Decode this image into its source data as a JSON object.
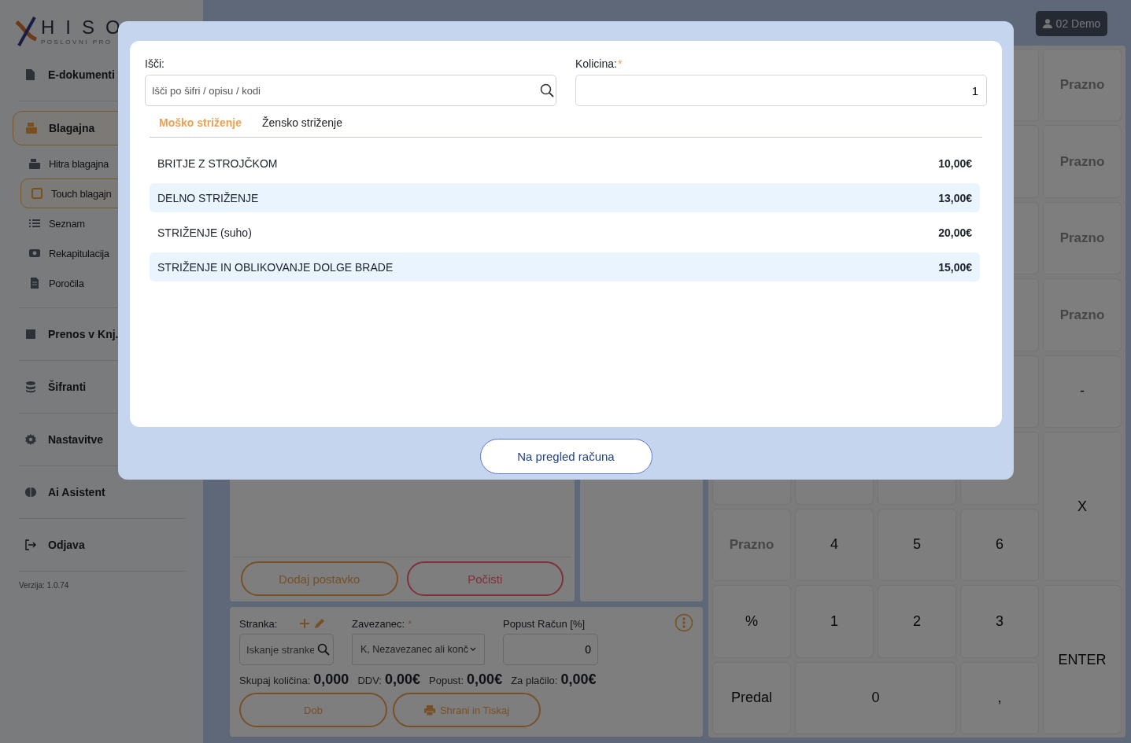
{
  "sidebar": {
    "logo": {
      "name": "HISO",
      "tagline": "POSLOVNI PRO"
    },
    "items": [
      {
        "label": "E-dokumenti",
        "selected": false
      },
      {
        "label": "Blagajna",
        "selected": true,
        "children": [
          {
            "label": "Hitra blagajna",
            "selected": false
          },
          {
            "label": "Touch blagajn",
            "selected": true
          },
          {
            "label": "Seznam",
            "selected": false
          },
          {
            "label": "Rekapitulacija",
            "selected": false
          },
          {
            "label": "Poročila",
            "selected": false
          }
        ]
      },
      {
        "label": "Prenos v Knj.",
        "selected": false
      },
      {
        "label": "Šifranti",
        "selected": false
      },
      {
        "label": "Nastavitve",
        "selected": false
      },
      {
        "label": "Ai Asistent",
        "selected": false
      },
      {
        "label": "Odjava",
        "selected": false
      }
    ],
    "version": "Verzija: 1.0.74"
  },
  "header": {
    "user_button": "02 Demo"
  },
  "receipt": {
    "buttons": [
      {
        "label": "Dodaj postavko",
        "kind": "add"
      },
      {
        "label": "Počisti",
        "kind": "clear"
      }
    ]
  },
  "customer": {
    "customer_label": "Stranka:",
    "customer_placeholder": "Iskanje stranke",
    "taxpayer_label": "Zavezanec:",
    "required_mark": "*",
    "taxpayer_value": "K, Nezavezanec ali konč",
    "discount_label": "Popust Račun [%]",
    "discount_value": "0",
    "totals": [
      {
        "label": "Skupaj količina:",
        "value": "0,000"
      },
      {
        "label": "DDV:",
        "value": "0,00€"
      },
      {
        "label": "Popust:",
        "value": "0,00€"
      },
      {
        "label": "Za plačilo:",
        "value": "0,00€"
      }
    ],
    "buttons": [
      {
        "label": "Dob",
        "kind": "plain"
      },
      {
        "label": "Shrani in Tiskaj",
        "kind": "print"
      }
    ]
  },
  "keypad": [
    {
      "label": "Prazno",
      "disabled": true
    },
    {
      "label": "Prazno",
      "disabled": true
    },
    {
      "label": "Prazno",
      "disabled": true
    },
    {
      "label": "Prazno",
      "disabled": true
    },
    {
      "label": "-",
      "disabled": false
    },
    {
      "label": "X",
      "disabled": false
    },
    {
      "label": "Prazno",
      "disabled": true
    },
    {
      "label": "4",
      "disabled": false
    },
    {
      "label": "5",
      "disabled": false
    },
    {
      "label": "6",
      "disabled": false
    },
    {
      "label": "%",
      "disabled": false
    },
    {
      "label": "1",
      "disabled": false
    },
    {
      "label": "2",
      "disabled": false
    },
    {
      "label": "3",
      "disabled": false
    },
    {
      "label": "ENTER",
      "disabled": false
    },
    {
      "label": "Predal",
      "disabled": false
    },
    {
      "label": "0",
      "disabled": false
    },
    {
      "label": ",",
      "disabled": false
    }
  ],
  "modal": {
    "search_label": "Išči:",
    "search_placeholder": "Išči po šifri / opisu / kodi",
    "quantity_label": "Kolicina:",
    "required_mark": "*",
    "quantity_value": "1",
    "tabs": [
      {
        "label": "Moško striženje",
        "selected": true
      },
      {
        "label": "Žensko striženje",
        "selected": false
      }
    ],
    "items": [
      {
        "name": "BRITJE Z STROJČKOM",
        "price": "10,00€"
      },
      {
        "name": "DELNO STRIŽENJE",
        "price": "13,00€"
      },
      {
        "name": "STRIŽENJE (suho)",
        "price": "20,00€"
      },
      {
        "name": "STRIŽENJE IN OBLIKOVANJE DOLGE BRADE",
        "price": "15,00€"
      }
    ],
    "button": "Na pregled računa"
  }
}
